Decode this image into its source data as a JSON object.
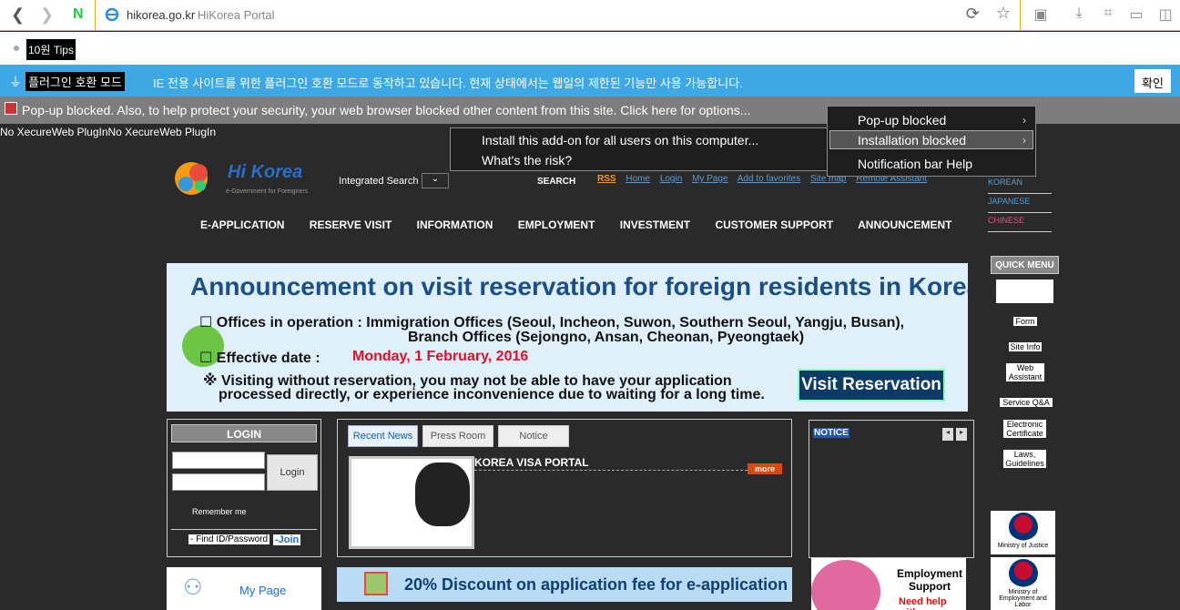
{
  "browser": {
    "back": "❮",
    "forward": "❯",
    "naver_logo": "N",
    "domain": "hikorea.go.kr",
    "page_title": "HiKorea Portal"
  },
  "bookmarks": {
    "tips": "10원 Tips"
  },
  "compat_bar": {
    "mode_label": "플러그인 호환 모드",
    "message": "IE 전용 사이트를 위한 플러그인 호환 모드로 동작하고 있습니다. 현재 상태에서는 웹일의 제한된 기능만 사용 가능합니다.",
    "ok_button": "확인"
  },
  "popup_bar": {
    "message": "Pop-up blocked. Also, to help protect your security, your web browser blocked other content from this site. Click here for options..."
  },
  "xecure_text": "No XecureWeb PlugInNo XecureWeb PlugIn",
  "context_menu": {
    "items": [
      "Pop-up blocked",
      "Installation blocked",
      "Notification bar Help"
    ],
    "submenu": [
      "Install this add-on for all users on this computer...",
      "What's the risk?"
    ]
  },
  "site": {
    "logo_text": "Hi Korea",
    "logo_sub": "e-Government for Foreigners",
    "integrated_search": "Integrated Search",
    "search_label": "SEARCH",
    "rss": "RSS",
    "top_links": [
      "Home",
      "Login",
      "My Page",
      "Add to favorites",
      "Site map",
      "Remote Assistant"
    ],
    "languages": [
      "KOREAN",
      "JAPANESE",
      "CHINESE"
    ],
    "main_nav": [
      "E-APPLICATION",
      "RESERVE VISIT",
      "INFORMATION",
      "EMPLOYMENT",
      "INVESTMENT",
      "CUSTOMER SUPPORT",
      "ANNOUNCEMENT"
    ]
  },
  "banner": {
    "headline": "Announcement on visit reservation for foreign residents in Korea",
    "line1": "☐ Offices in operation : Immigration Offices (Seoul, Incheon, Suwon, Southern Seoul, Yangju, Busan),",
    "line2": "Branch Offices (Sejongno, Ansan, Cheonan, Pyeongtaek)",
    "line3_label": "☐ Effective date :",
    "line3_date": "Monday, 1 February, 2016",
    "line4": "※ Visiting without reservation, you may not be able to have your application",
    "line5": "processed directly, or experience inconvenience due to waiting for a long time.",
    "button": "Visit Reservation"
  },
  "login": {
    "header": "LOGIN",
    "button": "Login",
    "remember": "Remember me",
    "find_id": "- Find ID/Password",
    "join": "-Join"
  },
  "news": {
    "tabs": [
      "Recent News",
      "Press Room",
      "Notice"
    ],
    "title": "KOREA VISA PORTAL",
    "more": "more"
  },
  "notice": {
    "label": "NOTICE",
    "prev": "◂",
    "next": "▸"
  },
  "quick_menu": {
    "header": "QUICK MENU",
    "items": [
      "Form",
      "Site Info",
      "Web Assistant",
      "Service Q&A",
      "Electronic Certificate",
      "Laws, Guidelines"
    ]
  },
  "ministries": [
    "Ministry of Justice",
    "Ministry of Employment and Labor"
  ],
  "bottom": {
    "my_page": "My Page",
    "discount": "20% Discount on application fee for e-application",
    "employment_title": "Employment Support",
    "employment_sub": "Need help with"
  }
}
